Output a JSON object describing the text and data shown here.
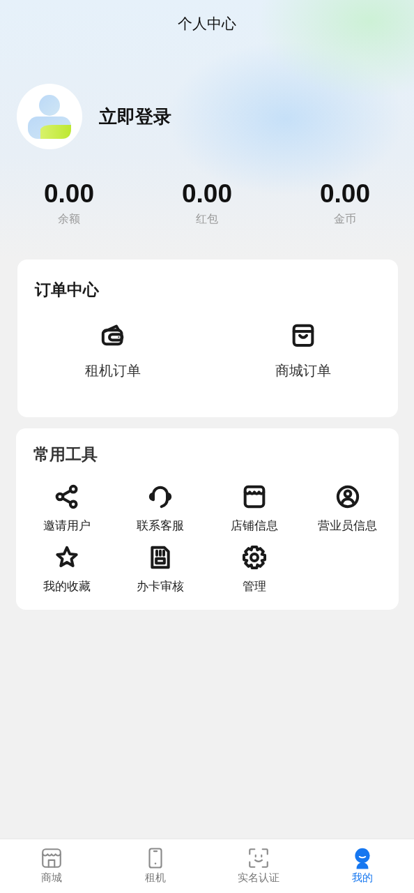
{
  "header": {
    "title": "个人中心"
  },
  "profile": {
    "login_label": "立即登录"
  },
  "stats": [
    {
      "value": "0.00",
      "label": "余额"
    },
    {
      "value": "0.00",
      "label": "红包"
    },
    {
      "value": "0.00",
      "label": "金币"
    }
  ],
  "order_center": {
    "title": "订单中心",
    "items": [
      {
        "label": "租机订单"
      },
      {
        "label": "商城订单"
      }
    ]
  },
  "tools": {
    "title": "常用工具",
    "items": [
      {
        "label": "邀请用户"
      },
      {
        "label": "联系客服"
      },
      {
        "label": "店铺信息"
      },
      {
        "label": "营业员信息"
      },
      {
        "label": "我的收藏"
      },
      {
        "label": "办卡审核"
      },
      {
        "label": "管理"
      }
    ]
  },
  "tab_bar": [
    {
      "label": "商城",
      "selected": false
    },
    {
      "label": "租机",
      "selected": false
    },
    {
      "label": "实名认证",
      "selected": false
    },
    {
      "label": "我的",
      "selected": true
    }
  ]
}
